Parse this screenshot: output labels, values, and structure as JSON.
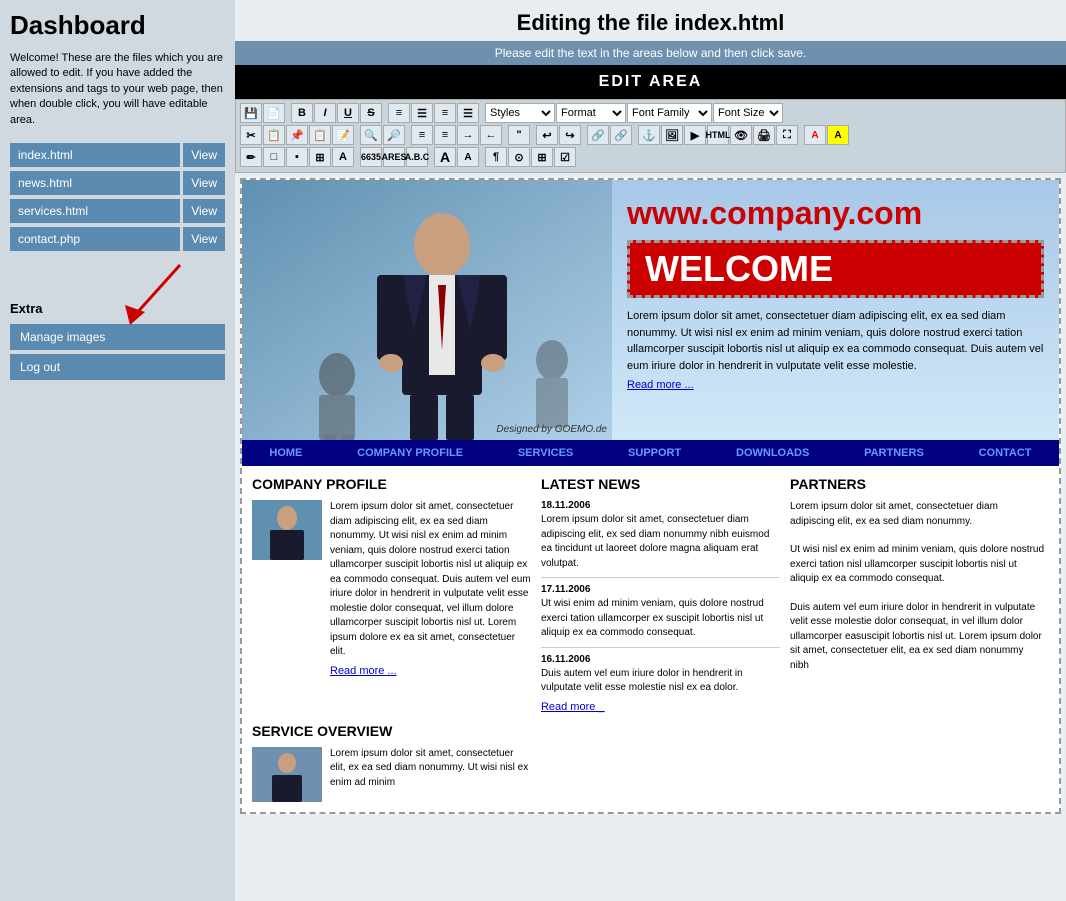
{
  "sidebar": {
    "title": "Dashboard",
    "description": "Welcome! These are the files which you are allowed to edit. If you have added the extensions and tags to your web page, then when double click, you will have editable area.",
    "files": [
      {
        "name": "index.html",
        "view": "View"
      },
      {
        "name": "news.html",
        "view": "View"
      },
      {
        "name": "services.html",
        "view": "View"
      },
      {
        "name": "contact.php",
        "view": "View"
      }
    ],
    "extra_label": "Extra",
    "manage_images": "Manage images",
    "logout": "Log out"
  },
  "main": {
    "page_title": "Editing the file index.html",
    "subtitle": "Please edit the text in the areas below and then click save.",
    "edit_area_label": "EDIT AREA"
  },
  "toolbar": {
    "styles_placeholder": "Styles",
    "format_placeholder": "Format",
    "font_family_placeholder": "Font Family",
    "font_size_placeholder": "Font Size"
  },
  "website": {
    "url": "www.company.com",
    "welcome": "WELCOME",
    "intro_text": "Lorem ipsum dolor sit amet, consectetuer diam adipiscing elit, ex ea sed diam nonummy. Ut wisi nisl ex enim ad minim veniam, quis dolore nostrud exerci tation ullamcorper suscipit lobortis nisl ut aliquip ex ea commodo consequat. Duis autem vel eum iriure dolor in hendrerit in vulputate velit esse molestie.",
    "read_more_1": "Read more ...",
    "designed_by": "Designed by GOEMO.de",
    "nav_items": [
      "HOME",
      "COMPANY PROFILE",
      "SERVICES",
      "SUPPORT",
      "DOWNLOADS",
      "PARTNERS",
      "CONTACT"
    ],
    "company_profile": {
      "title": "COMPANY PROFILE",
      "text": "Lorem ipsum dolor sit amet, consectetuer diam adipiscing elit, ex ea sed diam nonummy. Ut wisi nisl ex enim ad minim veniam, quis dolore nostrud exerci tation ullamcorper suscipit lobortis nisl ut aliquip ex ea commodo consequat. Duis autem vel eum iriure dolor in hendrerit in vulputate velit esse molestie dolor consequat, vel illum dolore ullamcorper suscipit lobortis nisl ut. Lorem ipsum dolore ex ea sit amet, consectetuer elit.",
      "read_more": "Read more ..."
    },
    "latest_news": {
      "title": "LATEST NEWS",
      "items": [
        {
          "date": "18.11.2006",
          "text": "Lorem ipsum dolor sit amet, consectetuer diam adipiscing elit, ex sed diam nonummy nibh euismod ea tincidunt ut laoreet dolore magna aliquam erat volutpat."
        },
        {
          "date": "17.11.2006",
          "text": "Ut wisi enim ad minim veniam, quis dolore nostrud exerci tation ullamcorper ex suscipit lobortis nisl ut aliquip ex ea commodo consequat."
        },
        {
          "date": "16.11.2006",
          "text": "Duis autem vel eum iriure dolor in hendrerit in vulputate velit esse molestie nisl ex ea dolor."
        }
      ],
      "read_more": "Read more _"
    },
    "partners": {
      "title": "PARTNERS",
      "text1": "Lorem ipsum dolor sit amet, consectetuer diam adipiscing elit, ex ea sed diam nonummy.",
      "text2": "Ut wisi nisl ex enim ad minim veniam, quis dolore nostrud exerci tation nisl ullamcorper suscipit lobortis nisl ut aliquip ex ea commodo consequat.",
      "text3": "Duis autem vel eum iriure dolor in hendrerit in vulputate velit esse molestie dolor consequat, in vel illum dolor ullamcorper easuscipit lobortis nisl ut. Lorem ipsum dolor sit amet, consectetuer elit, ea ex sed diam nonummy nibh"
    },
    "service_overview": {
      "title": "SERVICE OVERVIEW",
      "text": "Lorem ipsum dolor sit amet, consectetuer elit, ex ea sed diam nonummy. Ut wisi nisl ex enim ad minim"
    }
  }
}
